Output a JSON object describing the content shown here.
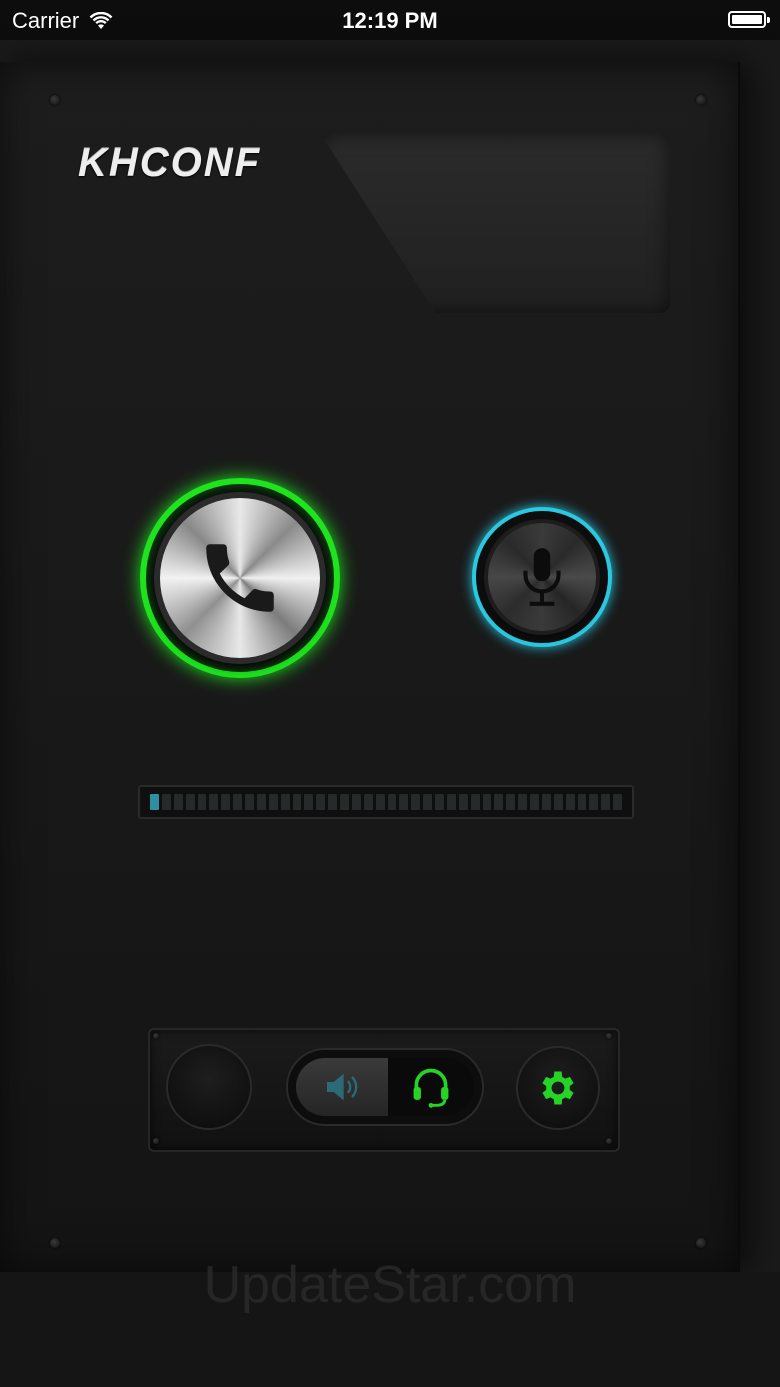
{
  "status_bar": {
    "carrier": "Carrier",
    "time": "12:19 PM"
  },
  "app": {
    "logo_text": "KHCONF"
  },
  "buttons": {
    "call": "phone-icon",
    "mic": "microphone-icon",
    "speaker": "speaker-icon",
    "headset": "headset-icon",
    "settings": "gear-icon"
  },
  "audio_level": {
    "fraction": 0.0,
    "lit_segments": 1,
    "segment_count": 40
  },
  "colors": {
    "call_ring": "#1ee31e",
    "mic_ring": "#2bc8e0",
    "headset_active": "#25d425",
    "settings_icon": "#25d425",
    "speaker_icon": "#2b6b78"
  },
  "watermark": "UpdateStar.com"
}
